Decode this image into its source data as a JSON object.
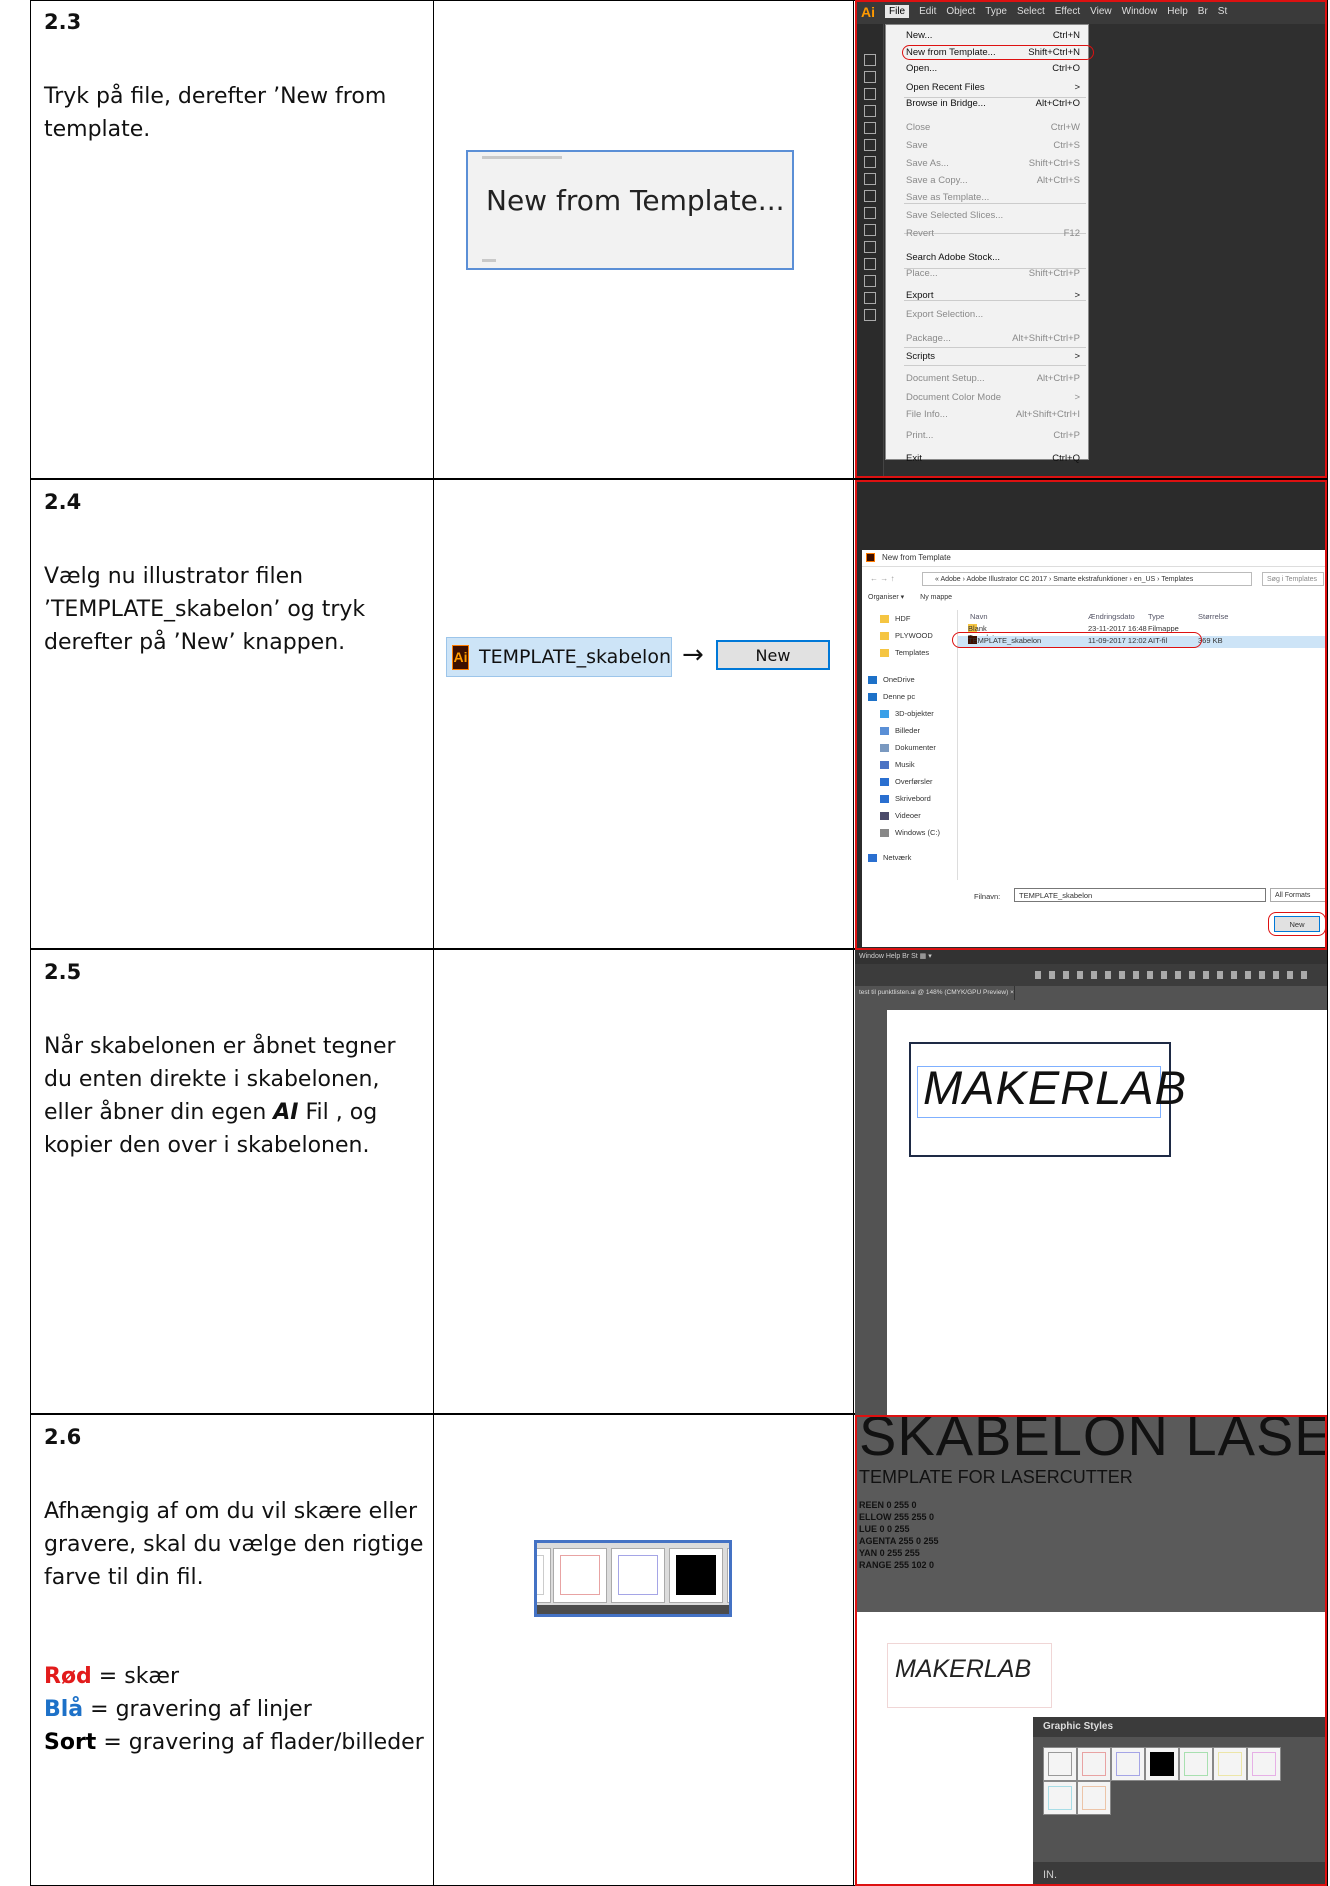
{
  "steps": [
    {
      "number": "2.3",
      "text": "Tryk på file, derefter ’New from template."
    },
    {
      "number": "2.4",
      "text": "Vælg nu illustrator filen ’TEMPLATE_skabelon’ og tryk derefter på ’New’ knappen."
    },
    {
      "number": "2.5",
      "text_parts": [
        "Når skabelonen er åbnet tegner du enten direkte i skabelonen, eller åbner din egen ",
        "AI",
        " Fil , og kopier den over i skabelonen."
      ]
    },
    {
      "number": "2.6",
      "text": "Afhængig af om du vil skære eller gravere, skal du vælge den rigtige farve til din fil.",
      "legend": [
        {
          "label": "Rød",
          "desc": " = skær"
        },
        {
          "label": "Blå",
          "desc": "  = gravering af linjer"
        },
        {
          "label": "Sort",
          "desc": " = gravering af flader/billeder"
        }
      ]
    }
  ],
  "middle": {
    "menu_item_label": "New from Template...",
    "file_chip": {
      "badge": "Ai",
      "name": "TEMPLATE_skabelon"
    },
    "arrow": "→",
    "new_button": "New"
  },
  "shot1": {
    "logo": "Ai",
    "menubar": [
      "File",
      "Edit",
      "Object",
      "Type",
      "Select",
      "Effect",
      "View",
      "Window",
      "Help",
      "Br",
      "St"
    ],
    "menu_items": [
      {
        "label": "New...",
        "shortcut": "Ctrl+N",
        "dim": false
      },
      {
        "label": "New from Template...",
        "shortcut": "Shift+Ctrl+N",
        "dim": false
      },
      {
        "label": "Open...",
        "shortcut": "Ctrl+O",
        "dim": false
      },
      {
        "label": "Open Recent Files",
        "shortcut": ">",
        "dim": false
      },
      {
        "label": "Browse in Bridge...",
        "shortcut": "Alt+Ctrl+O",
        "dim": false
      },
      {
        "label": "Close",
        "shortcut": "Ctrl+W",
        "dim": true
      },
      {
        "label": "Save",
        "shortcut": "Ctrl+S",
        "dim": true
      },
      {
        "label": "Save As...",
        "shortcut": "Shift+Ctrl+S",
        "dim": true
      },
      {
        "label": "Save a Copy...",
        "shortcut": "Alt+Ctrl+S",
        "dim": true
      },
      {
        "label": "Save as Template...",
        "shortcut": "",
        "dim": true
      },
      {
        "label": "Save Selected Slices...",
        "shortcut": "",
        "dim": true
      },
      {
        "label": "Revert",
        "shortcut": "F12",
        "dim": true
      },
      {
        "label": "Search Adobe Stock...",
        "shortcut": "",
        "dim": false
      },
      {
        "label": "Place...",
        "shortcut": "Shift+Ctrl+P",
        "dim": true
      },
      {
        "label": "Export",
        "shortcut": ">",
        "dim": false
      },
      {
        "label": "Export Selection...",
        "shortcut": "",
        "dim": true
      },
      {
        "label": "Package...",
        "shortcut": "Alt+Shift+Ctrl+P",
        "dim": true
      },
      {
        "label": "Scripts",
        "shortcut": ">",
        "dim": false
      },
      {
        "label": "Document Setup...",
        "shortcut": "Alt+Ctrl+P",
        "dim": true
      },
      {
        "label": "Document Color Mode",
        "shortcut": ">",
        "dim": true
      },
      {
        "label": "File Info...",
        "shortcut": "Alt+Shift+Ctrl+I",
        "dim": true
      },
      {
        "label": "Print...",
        "shortcut": "Ctrl+P",
        "dim": true
      },
      {
        "label": "Exit",
        "shortcut": "Ctrl+Q",
        "dim": false
      }
    ]
  },
  "shot2": {
    "title": "New from Template",
    "address": "« Adobe › Adobe Illustrator CC 2017 › Smarte ekstrafunktioner › en_US › Templates",
    "search_placeholder": "Søg i Templates",
    "toolbar": [
      "Organiser ▾",
      "Ny mappe"
    ],
    "nav": [
      {
        "label": "HDF",
        "color": "#f5c542"
      },
      {
        "label": "PLYWOOD",
        "color": "#f5c542"
      },
      {
        "label": "Templates",
        "color": "#f5c542"
      },
      {
        "label": "OneDrive",
        "color": "#1d71c8"
      },
      {
        "label": "Denne pc",
        "color": "#1d71c8"
      },
      {
        "label": "3D-objekter",
        "color": "#3aa0e8"
      },
      {
        "label": "Billeder",
        "color": "#5a8fd6"
      },
      {
        "label": "Dokumenter",
        "color": "#7a99c0"
      },
      {
        "label": "Musik",
        "color": "#4a72c4"
      },
      {
        "label": "Overførsler",
        "color": "#2a6fd0"
      },
      {
        "label": "Skrivebord",
        "color": "#2a6fd0"
      },
      {
        "label": "Videoer",
        "color": "#4a4a6a"
      },
      {
        "label": "Windows (C:)",
        "color": "#888888"
      },
      {
        "label": "Netværk",
        "color": "#2a6fd0"
      }
    ],
    "columns": [
      "Navn",
      "Ændringsdato",
      "Type",
      "Størrelse"
    ],
    "rows": [
      {
        "name": "Blank Templates",
        "date": "23-11-2017 16:48",
        "type": "Filmappe",
        "size": ""
      },
      {
        "name": "TEMPLATE_skabelon",
        "date": "11-09-2017 12:02",
        "type": "AIT-fil",
        "size": "369 KB"
      }
    ],
    "filename_label": "Filnavn:",
    "filename_value": "TEMPLATE_skabelon",
    "format": "All Formats",
    "new_button": "New"
  },
  "shot3": {
    "menubar": "Window   Help   Br   St   ▦ ▾",
    "doc_tab": "test til punktlisten.ai @ 148% (CMYK/GPU Preview)  ×",
    "word": "MAKERLAB"
  },
  "shot4": {
    "big_title": "SKABELON LASERSK",
    "sub_title": "TEMPLATE FOR LASERCUTTER",
    "codes": [
      "REEN 0 255 0",
      "ELLOW 255 255 0",
      "LUE 0 0 255",
      "AGENTA 255 0 255",
      "YAN 0 255 255",
      "RANGE 255 102 0"
    ],
    "word": "MAKERLAB",
    "panel_title": "Graphic Styles",
    "panel_footer": "IN."
  },
  "colors": {
    "cut": "#e21b1b",
    "engrave_line": "#1d71c8",
    "engrave_fill": "#000000"
  }
}
